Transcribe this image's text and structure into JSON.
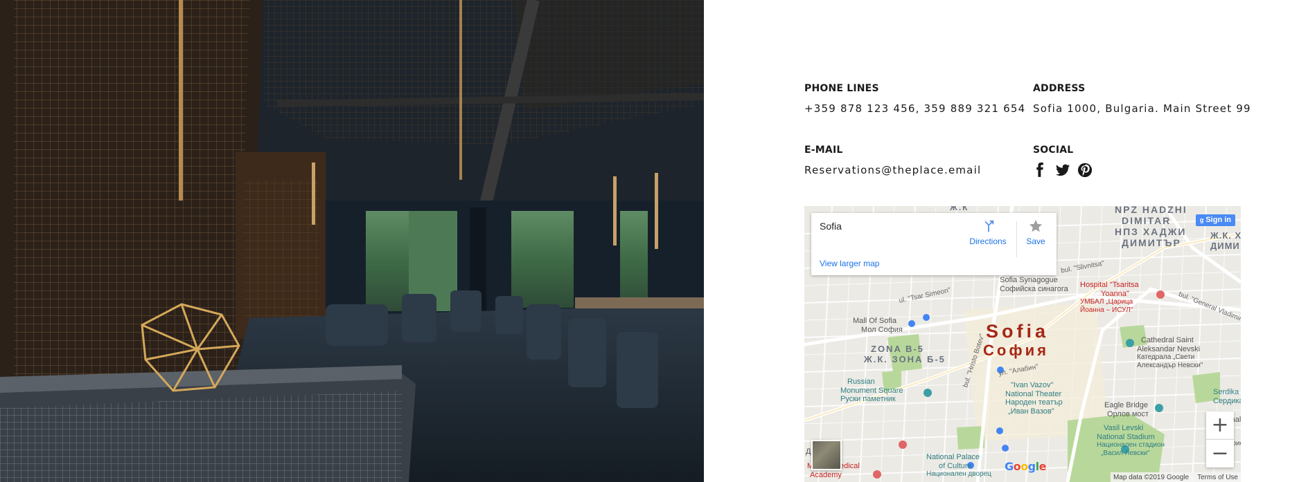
{
  "contact": {
    "phone": {
      "label": "PHONE LINES",
      "value": "+359 878 123 456, 359 889 321 654"
    },
    "address": {
      "label": "ADDRESS",
      "value": "Sofia 1000, Bulgaria. Main Street 99"
    },
    "email": {
      "label": "E-MAIL",
      "value": "Reservations@theplace.email"
    },
    "social": {
      "label": "SOCIAL",
      "icons": [
        "facebook-icon",
        "twitter-icon",
        "pinterest-icon"
      ]
    }
  },
  "map": {
    "place_name": "Sofia",
    "directions_label": "Directions",
    "save_label": "Save",
    "larger_map_link": "View larger map",
    "sign_in_label": "Sign in",
    "zoom_in": "+",
    "zoom_out": "−",
    "attribution": "Map data ©2019 Google",
    "terms": "Terms of Use",
    "city_label": "Sofia",
    "city_label_bg": "София",
    "labels": {
      "npz_1": "NPZ HADZHI",
      "npz_2": "DIMITAR",
      "npz_3": "НПЗ ХАДЖИ",
      "npz_4": "ДИМИТЪР",
      "zk_top": "Ж.К",
      "zk_right1": "Ж.К. Х.",
      "zk_right2": "ДИМИ",
      "synagogue_1": "Sofia Synagogue",
      "synagogue_2": "Софийска синагога",
      "hospital_1": "Hospital \"Tsaritsa",
      "hospital_2": "Yoanna\"",
      "hospital_3": "УМБАЛ „Царица",
      "hospital_4": "Йоанна – ИСУЛ\"",
      "mall_1": "Mall Of Sofia",
      "mall_2": "Мол София",
      "zona_1": "ZONA B-5",
      "zona_2": "Ж.К. ЗОНА Б-5",
      "tsar_simeon": "ul. \"Tsar Simeon\"",
      "slivnitsa": "bul. \"Slivnitsa\"",
      "general": "bul. \"General Vladimir",
      "hristo": "bul. \"Hristo Botev\"",
      "alabin": "ул. \"Алабин\"",
      "cathedral_1": "Cathedral Saint",
      "cathedral_2": "Aleksandar Nevski",
      "cathedral_3": "Катедрала „Свети",
      "cathedral_4": "Александър Невски\"",
      "russian_1": "Russian",
      "russian_2": "Monument Square",
      "russian_3": "Руски паметник",
      "vazov_1": "\"Ivan Vazov\"",
      "vazov_2": "National Theater",
      "vazov_3": "Народен театър",
      "vazov_4": "„Иван Вазов\"",
      "eagle_1": "Eagle Bridge",
      "eagle_2": "Орлов мост",
      "serdika_1": "Serdika",
      "serdika_2": "Сердика",
      "levski_1": "Vasil Levski",
      "levski_2": "National Stadium",
      "levski_3": "Национален стадион",
      "levski_4": "„Васил Левски\"",
      "palace_1": "National Palace",
      "palace_2": "of Culture",
      "palace_3": "Национален дворец",
      "military_1": "Military Medical",
      "military_2": "Academy",
      "national_w": "National W",
      "voenno": "военноист",
      "de": "Де"
    }
  },
  "colors": {
    "text_dark": "#1a1a1a",
    "link_blue": "#1a73e8",
    "city_label": "#a52714",
    "park_green": "#b8d89b"
  }
}
